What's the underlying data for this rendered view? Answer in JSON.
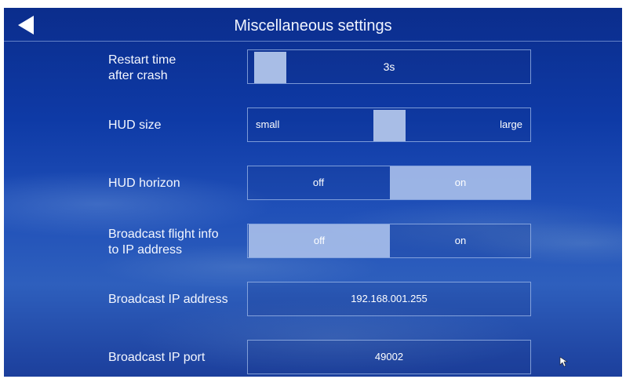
{
  "header": {
    "title": "Miscellaneous settings",
    "back_icon": "back-arrow-icon"
  },
  "settings": {
    "restart_time": {
      "label": "Restart time\nafter crash",
      "value": "3s",
      "slider_fraction": 0.0
    },
    "hud_size": {
      "label": "HUD size",
      "min_label": "small",
      "max_label": "large",
      "slider_fraction": 0.5
    },
    "hud_horizon": {
      "label": "HUD horizon",
      "off_label": "off",
      "on_label": "on",
      "selected": "on"
    },
    "broadcast_flight_info": {
      "label": "Broadcast flight info\nto IP address",
      "off_label": "off",
      "on_label": "on",
      "selected": "off"
    },
    "broadcast_ip_address": {
      "label": "Broadcast IP address",
      "value": "192.168.001.255"
    },
    "broadcast_ip_port": {
      "label": "Broadcast IP port",
      "value": "49002"
    }
  },
  "colors": {
    "accent": "#a8bde6",
    "background": "#0e3aa6"
  }
}
